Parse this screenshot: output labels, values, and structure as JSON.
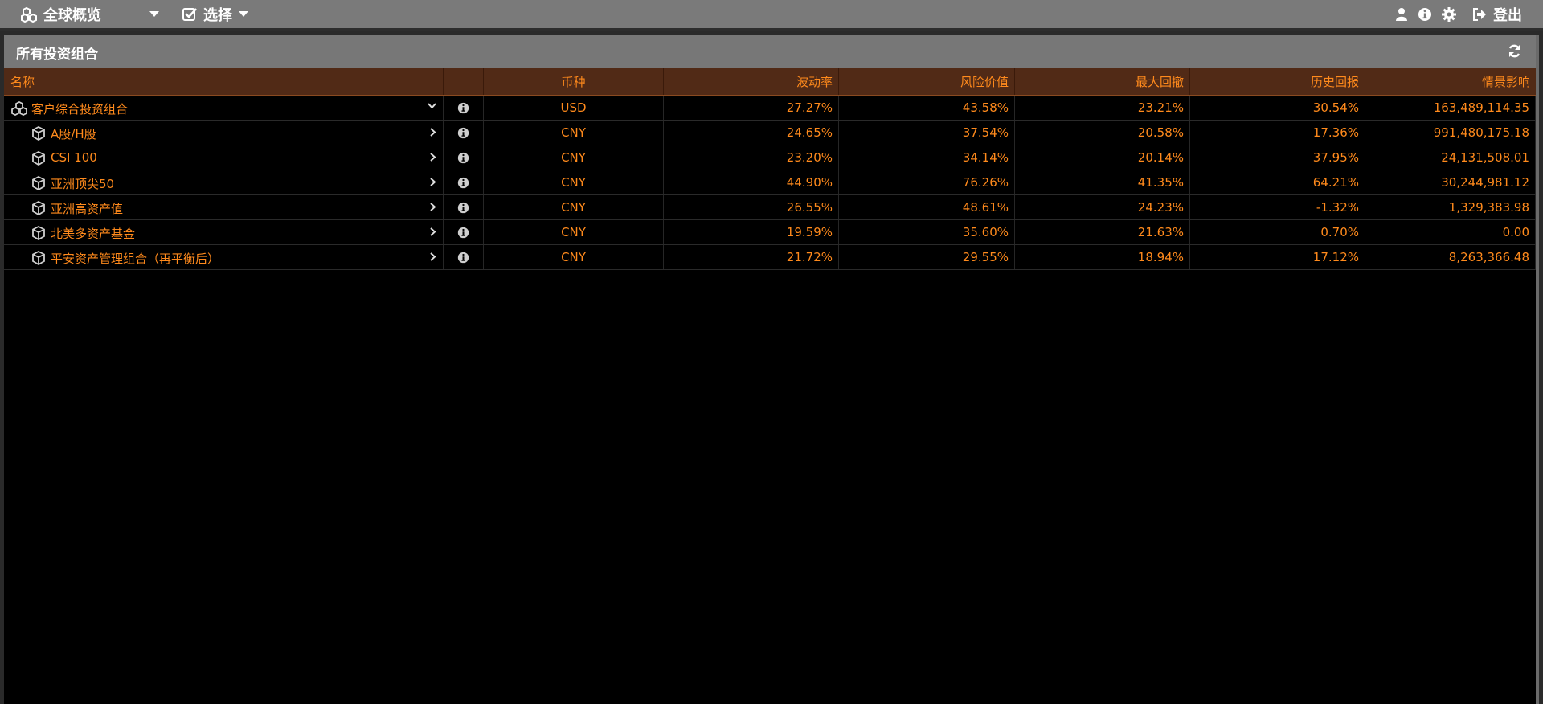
{
  "topbar": {
    "global_overview_label": "全球概览",
    "select_label": "选择",
    "logout_label": "登出",
    "icons": [
      "user-icon",
      "info-icon",
      "gear-icon",
      "logout-icon"
    ]
  },
  "panel": {
    "title": "所有投资组合"
  },
  "table": {
    "columns": {
      "name": "名称",
      "info": "",
      "currency": "币种",
      "volatility": "波动率",
      "var": "风险价值",
      "max_drawdown": "最大回撤",
      "hist_return": "历史回报",
      "scenario_impact": "情景影响"
    },
    "rows": [
      {
        "name": "客户综合投资组合",
        "currency": "USD",
        "volatility": "27.27%",
        "var": "43.58%",
        "max_drawdown": "23.21%",
        "hist_return": "30.54%",
        "scenario_impact": "163,489,114.35"
      },
      {
        "name": "A股/H股",
        "currency": "CNY",
        "volatility": "24.65%",
        "var": "37.54%",
        "max_drawdown": "20.58%",
        "hist_return": "17.36%",
        "scenario_impact": "991,480,175.18"
      },
      {
        "name": "CSI 100",
        "currency": "CNY",
        "volatility": "23.20%",
        "var": "34.14%",
        "max_drawdown": "20.14%",
        "hist_return": "37.95%",
        "scenario_impact": "24,131,508.01"
      },
      {
        "name": "亚洲顶尖50",
        "currency": "CNY",
        "volatility": "44.90%",
        "var": "76.26%",
        "max_drawdown": "41.35%",
        "hist_return": "64.21%",
        "scenario_impact": "30,244,981.12"
      },
      {
        "name": "亚洲高资产值",
        "currency": "CNY",
        "volatility": "26.55%",
        "var": "48.61%",
        "max_drawdown": "24.23%",
        "hist_return": "-1.32%",
        "scenario_impact": "1,329,383.98"
      },
      {
        "name": "北美多资产基金",
        "currency": "CNY",
        "volatility": "19.59%",
        "var": "35.60%",
        "max_drawdown": "21.63%",
        "hist_return": "0.70%",
        "scenario_impact": "0.00"
      },
      {
        "name": "平安资产管理组合（再平衡后）",
        "currency": "CNY",
        "volatility": "21.72%",
        "var": "29.55%",
        "max_drawdown": "18.94%",
        "hist_return": "17.12%",
        "scenario_impact": "8,263,366.48"
      }
    ]
  },
  "colors": {
    "accent": "#ff8a1c",
    "header_bg": "#512a16",
    "topbar_bg": "#7a7a7a"
  }
}
